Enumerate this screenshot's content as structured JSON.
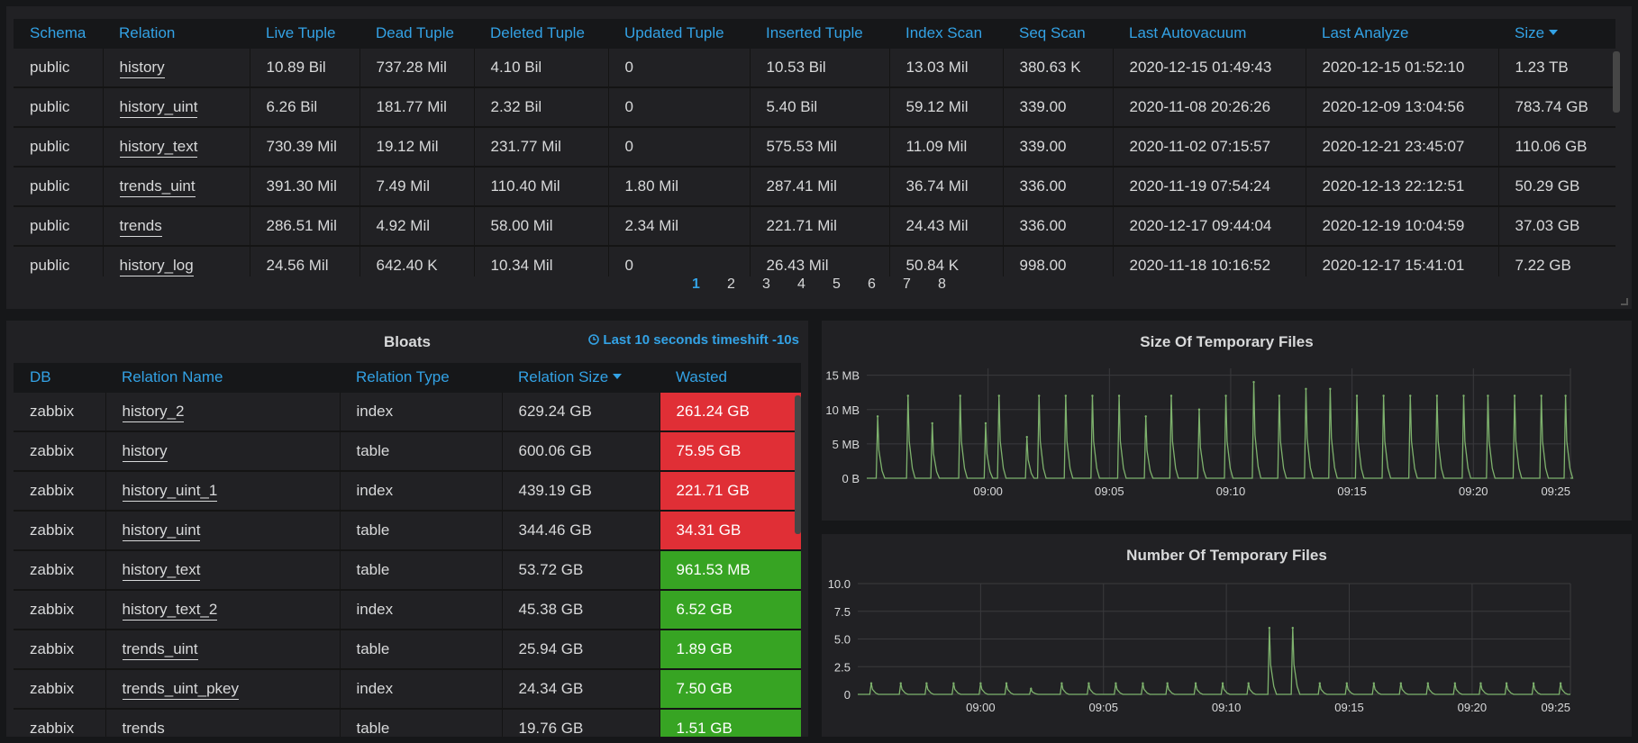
{
  "top_table": {
    "columns": [
      "Schema",
      "Relation",
      "Live Tuple",
      "Dead Tuple",
      "Deleted Tuple",
      "Updated Tuple",
      "Inserted Tuple",
      "Index Scan",
      "Seq Scan",
      "Last Autovacuum",
      "Last Analyze",
      "Size"
    ],
    "sorted_column": "Size",
    "rows": [
      [
        "public",
        "history",
        "10.89 Bil",
        "737.28 Mil",
        "4.10 Bil",
        "0",
        "10.53 Bil",
        "13.03 Mil",
        "380.63 K",
        "2020-12-15 01:49:43",
        "2020-12-15 01:52:10",
        "1.23 TB"
      ],
      [
        "public",
        "history_uint",
        "6.26 Bil",
        "181.77 Mil",
        "2.32 Bil",
        "0",
        "5.40 Bil",
        "59.12 Mil",
        "339.00",
        "2020-11-08 20:26:26",
        "2020-12-09 13:04:56",
        "783.74 GB"
      ],
      [
        "public",
        "history_text",
        "730.39 Mil",
        "19.12 Mil",
        "231.77 Mil",
        "0",
        "575.53 Mil",
        "11.09 Mil",
        "339.00",
        "2020-11-02 07:15:57",
        "2020-12-21 23:45:07",
        "110.06 GB"
      ],
      [
        "public",
        "trends_uint",
        "391.30 Mil",
        "7.49 Mil",
        "110.40 Mil",
        "1.80 Mil",
        "287.41 Mil",
        "36.74 Mil",
        "336.00",
        "2020-11-19 07:54:24",
        "2020-12-13 22:12:51",
        "50.29 GB"
      ],
      [
        "public",
        "trends",
        "286.51 Mil",
        "4.92 Mil",
        "58.00 Mil",
        "2.34 Mil",
        "221.71 Mil",
        "24.43 Mil",
        "336.00",
        "2020-12-17 09:44:04",
        "2020-12-19 10:04:59",
        "37.03 GB"
      ],
      [
        "public",
        "history_log",
        "24.56 Mil",
        "642.40 K",
        "10.34 Mil",
        "0",
        "26.43 Mil",
        "50.84 K",
        "998.00",
        "2020-11-18 10:16:52",
        "2020-12-17 15:41:01",
        "7.22 GB"
      ]
    ],
    "pages": [
      "1",
      "2",
      "3",
      "4",
      "5",
      "6",
      "7",
      "8"
    ],
    "active_page": "1"
  },
  "bloats": {
    "title": "Bloats",
    "timeshift": "Last 10 seconds timeshift -10s",
    "columns": [
      "DB",
      "Relation Name",
      "Relation Type",
      "Relation Size",
      "Wasted"
    ],
    "sorted_column": "Relation Size",
    "rows": [
      {
        "db": "zabbix",
        "name": "history_2",
        "type": "index",
        "size": "629.24 GB",
        "wasted": "261.24 GB",
        "status": "red"
      },
      {
        "db": "zabbix",
        "name": "history",
        "type": "table",
        "size": "600.06 GB",
        "wasted": "75.95 GB",
        "status": "red"
      },
      {
        "db": "zabbix",
        "name": "history_uint_1",
        "type": "index",
        "size": "439.19 GB",
        "wasted": "221.71 GB",
        "status": "red"
      },
      {
        "db": "zabbix",
        "name": "history_uint",
        "type": "table",
        "size": "344.46 GB",
        "wasted": "34.31 GB",
        "status": "red"
      },
      {
        "db": "zabbix",
        "name": "history_text",
        "type": "table",
        "size": "53.72 GB",
        "wasted": "961.53 MB",
        "status": "green"
      },
      {
        "db": "zabbix",
        "name": "history_text_2",
        "type": "index",
        "size": "45.38 GB",
        "wasted": "6.52 GB",
        "status": "green"
      },
      {
        "db": "zabbix",
        "name": "trends_uint",
        "type": "table",
        "size": "25.94 GB",
        "wasted": "1.89 GB",
        "status": "green"
      },
      {
        "db": "zabbix",
        "name": "trends_uint_pkey",
        "type": "index",
        "size": "24.34 GB",
        "wasted": "7.50 GB",
        "status": "green"
      },
      {
        "db": "zabbix",
        "name": "trends",
        "type": "table",
        "size": "19.76 GB",
        "wasted": "1.51 GB",
        "status": "green"
      }
    ],
    "colors": {
      "red": "#e02f36",
      "green": "#37a423"
    }
  },
  "chart_data": [
    {
      "type": "line",
      "title": "Size Of Temporary Files",
      "x_unit": "minutes",
      "xlim": [
        0,
        29
      ],
      "x_ticks": [
        5,
        10,
        15,
        20,
        25,
        29
      ],
      "x_tick_labels": [
        "09:00",
        "09:05",
        "09:10",
        "09:15",
        "09:20",
        "09:25"
      ],
      "ylim": [
        0,
        16
      ],
      "y_ticks": [
        0,
        5,
        10,
        15
      ],
      "y_tick_labels": [
        "0 B",
        "5 MB",
        "10 MB",
        "15 MB"
      ],
      "series": [
        {
          "color": "#7eb26d",
          "spikes": [
            [
              0.45,
              9
            ],
            [
              1.7,
              12
            ],
            [
              2.7,
              8
            ],
            [
              3.85,
              12
            ],
            [
              4.9,
              8
            ],
            [
              5.45,
              12
            ],
            [
              6.6,
              6
            ],
            [
              7.1,
              12
            ],
            [
              8.2,
              12
            ],
            [
              9.3,
              12
            ],
            [
              10.4,
              12
            ],
            [
              11.5,
              9
            ],
            [
              12.55,
              12
            ],
            [
              13.7,
              10
            ],
            [
              14.8,
              12
            ],
            [
              15.95,
              14
            ],
            [
              17.0,
              12
            ],
            [
              18.1,
              13
            ],
            [
              19.1,
              13
            ],
            [
              20.2,
              12
            ],
            [
              21.3,
              12
            ],
            [
              22.4,
              12
            ],
            [
              23.5,
              12
            ],
            [
              24.6,
              12
            ],
            [
              25.6,
              12
            ],
            [
              26.7,
              12
            ],
            [
              27.8,
              12
            ],
            [
              28.8,
              12
            ]
          ]
        }
      ],
      "grid": true
    },
    {
      "type": "line",
      "title": "Number Of Temporary Files",
      "x_unit": "minutes",
      "xlim": [
        0,
        29
      ],
      "x_ticks": [
        5,
        10,
        15,
        20,
        25,
        29
      ],
      "x_tick_labels": [
        "09:00",
        "09:05",
        "09:10",
        "09:15",
        "09:20",
        "09:25"
      ],
      "ylim": [
        0,
        10
      ],
      "y_ticks": [
        0,
        2.5,
        5.0,
        7.5,
        10.0
      ],
      "y_tick_labels": [
        "0",
        "2.5",
        "5.0",
        "7.5",
        "10.0"
      ],
      "series": [
        {
          "color": "#7eb26d",
          "spikes": [
            [
              0.55,
              1
            ],
            [
              1.75,
              1
            ],
            [
              2.8,
              1
            ],
            [
              3.9,
              1
            ],
            [
              5.0,
              1
            ],
            [
              6.05,
              1
            ],
            [
              7.05,
              0.5
            ],
            [
              8.3,
              1
            ],
            [
              9.4,
              1
            ],
            [
              10.5,
              1
            ],
            [
              11.6,
              1
            ],
            [
              12.6,
              1
            ],
            [
              13.75,
              1
            ],
            [
              14.85,
              1
            ],
            [
              15.9,
              1
            ],
            [
              16.75,
              6
            ],
            [
              17.7,
              6
            ],
            [
              18.8,
              1
            ],
            [
              19.9,
              1
            ],
            [
              21.0,
              1
            ],
            [
              22.1,
              1
            ],
            [
              23.2,
              1
            ],
            [
              24.3,
              1
            ],
            [
              25.35,
              1
            ],
            [
              26.4,
              1
            ],
            [
              27.5,
              1
            ],
            [
              28.6,
              1
            ]
          ]
        }
      ],
      "grid": true
    }
  ]
}
